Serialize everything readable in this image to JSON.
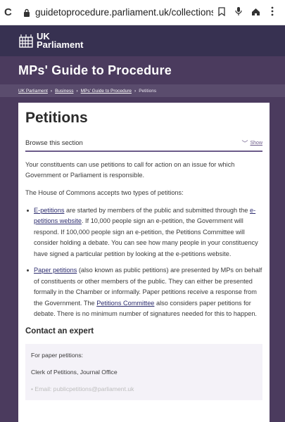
{
  "browser": {
    "url": "guidetoprocedure.parliament.uk/collections/cDdOWeLu",
    "reload_icon": "reload-icon",
    "lock_icon": "lock-icon",
    "bookmark_icon": "bookmark-icon",
    "mic_icon": "microphone-icon",
    "home_icon": "home-icon",
    "menu_icon": "kebab-menu-icon"
  },
  "header": {
    "logo_line1": "UK",
    "logo_line2": "Parliament",
    "site_title": "MPs' Guide to Procedure"
  },
  "breadcrumb": {
    "items": [
      "UK Parliament",
      "Business",
      "MPs' Guide to Procedure"
    ],
    "current": "Petitions"
  },
  "main": {
    "title": "Petitions",
    "browse_label": "Browse this section",
    "show_label": "Show",
    "intro": "Your constituents can use petitions to call for action on an issue for which Government or Parliament is responsible.",
    "types_intro": "The House of Commons accepts two types of petitions:",
    "item1": {
      "link": "E-petitions",
      "text_a": " are started by members of the public and submitted through the ",
      "link2": "e-petitions website",
      "text_b": ". If 10,000 people sign an e-petition, the Government will respond. If 100,000 people sign an e-petition, the Petitions Committee will consider holding a debate. You can see how many people in your constituency have signed a particular petition by looking at the e-petitions website."
    },
    "item2": {
      "link": "Paper petitions",
      "text_a": " (also known as public petitions) are presented by MPs on behalf of constituents or other members of the public. They can either be presented formally in the Chamber or informally. Paper petitions receive a response from the Government. The ",
      "link2": "Petitions Committee",
      "text_b": " also considers paper petitions for debate. There is no minimum number of signatures needed for this to happen."
    },
    "contact_heading": "Contact an expert",
    "expert_line1": "For paper petitions:",
    "expert_line2": "Clerk of Petitions, Journal Office",
    "expert_line3": "• Email: publicpetitions@parliament.uk"
  },
  "colors": {
    "header_dark": "#373151",
    "title_bar": "#4b3b5e",
    "accent": "#6c5b8a"
  }
}
